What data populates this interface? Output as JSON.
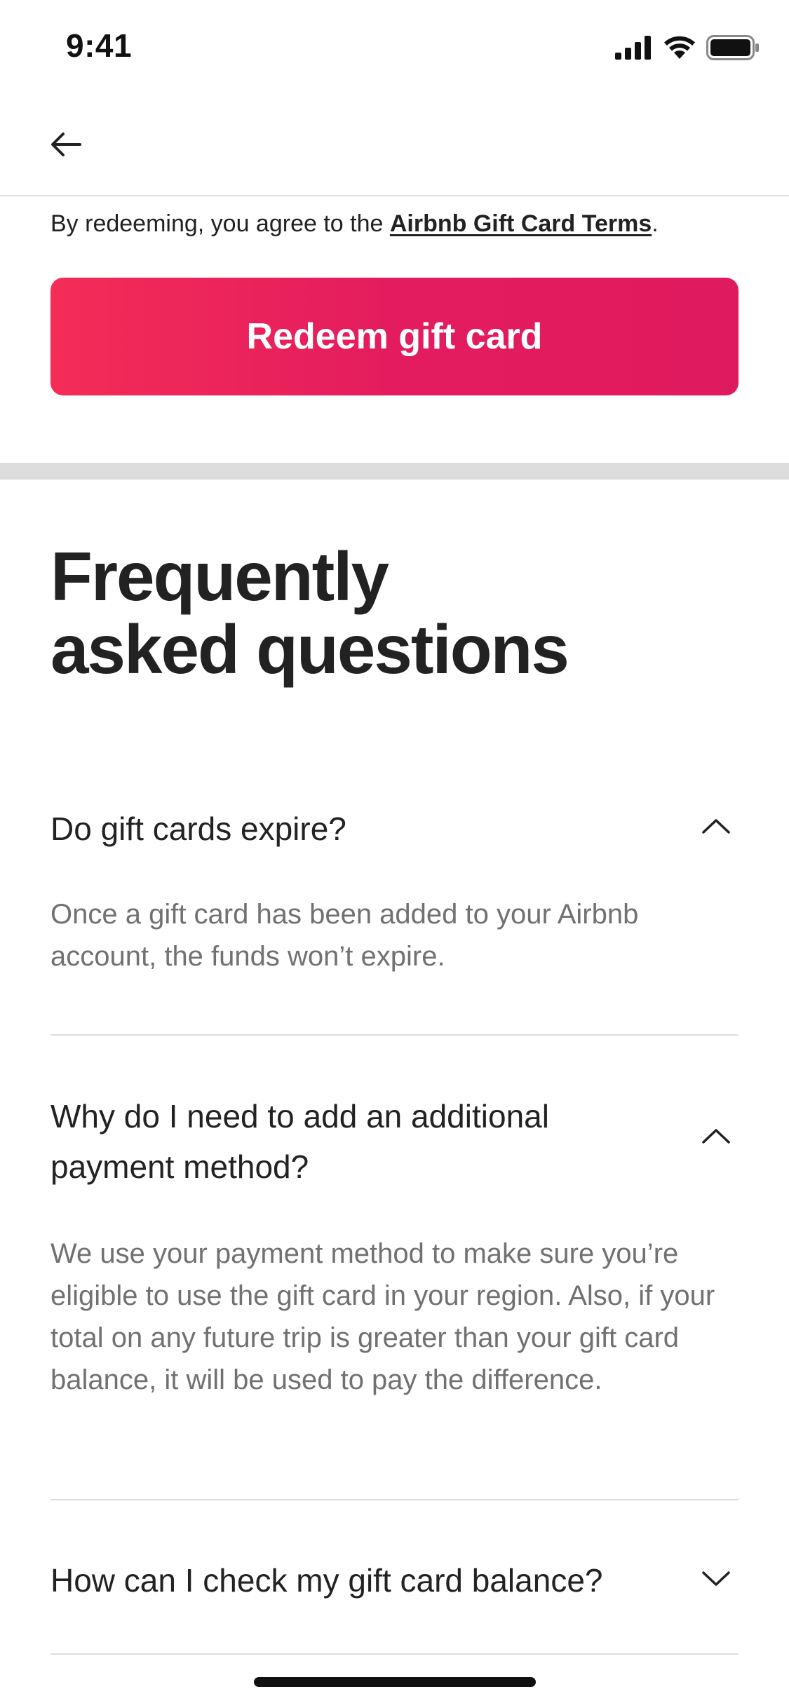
{
  "status_bar": {
    "time": "9:41"
  },
  "nav": {
    "back_icon": "arrow-left-icon"
  },
  "terms": {
    "prefix": "By redeeming, you agree to the ",
    "link_label": "Airbnb Gift Card Terms",
    "suffix": "."
  },
  "redeem_button": {
    "label": "Redeem gift card"
  },
  "faq": {
    "title_line1": "Frequently",
    "title_line2": "asked questions",
    "items": [
      {
        "question": "Do gift cards expire?",
        "answer": "Once a gift card has been added to your Airbnb account, the funds won’t expire.",
        "expanded": true,
        "toggle_icon": "chevron-up-icon"
      },
      {
        "question": "Why do I need to add an additional payment method?",
        "answer": "We use your payment method to make sure you’re eligible to use the gift card in your region. Also, if your total on any future trip is greater than your gift card balance, it will be used to pay the difference.",
        "expanded": true,
        "toggle_icon": "chevron-up-icon"
      },
      {
        "question": "How can I check my gift card balance?",
        "answer": "",
        "expanded": false,
        "toggle_icon": "chevron-down-icon"
      }
    ]
  },
  "colors": {
    "brand": "#e31c5f",
    "brand_light": "#f42c57",
    "text_primary": "#222222",
    "text_secondary": "#717171",
    "divider": "#dddddd"
  }
}
